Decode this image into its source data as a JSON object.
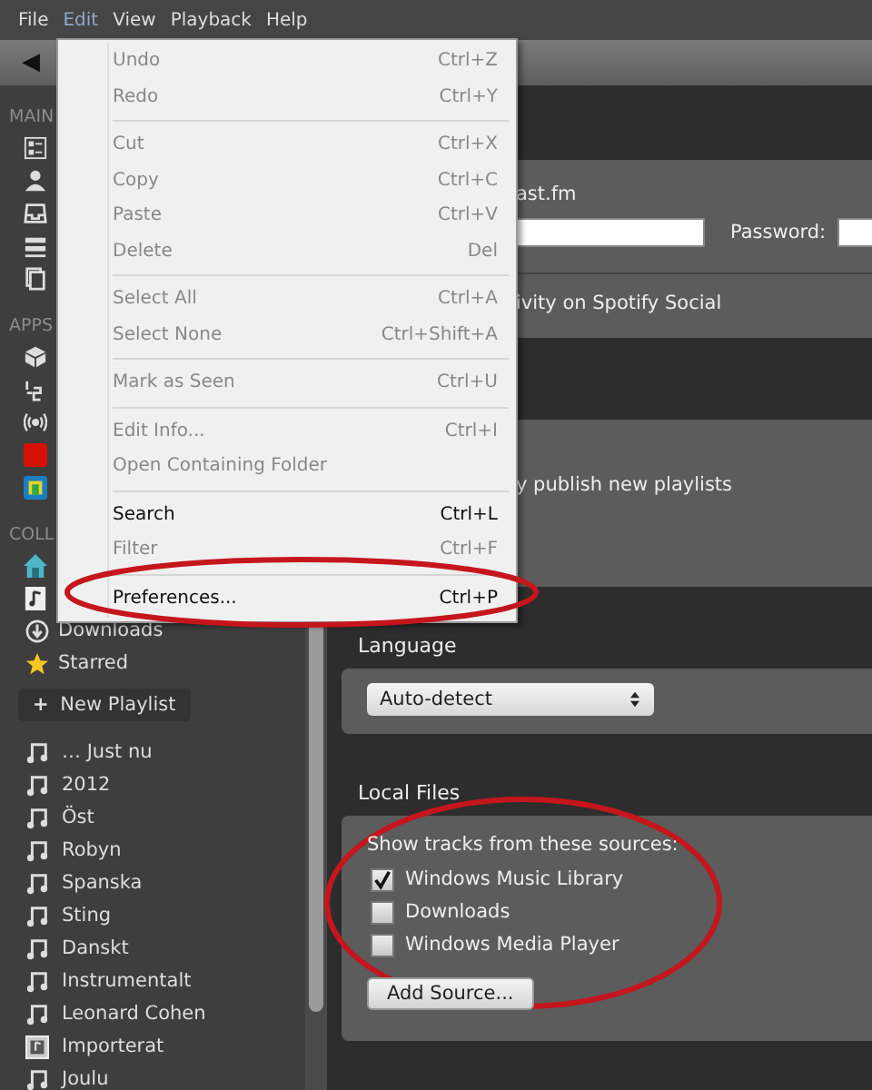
{
  "menubar": [
    {
      "label": "File",
      "selected": false
    },
    {
      "label": "Edit",
      "selected": true
    },
    {
      "label": "View",
      "selected": false
    },
    {
      "label": "Playback",
      "selected": false
    },
    {
      "label": "Help",
      "selected": false
    }
  ],
  "toolbar": {
    "back": "◀"
  },
  "sidebar": {
    "sections": [
      {
        "label": "MAIN"
      },
      {
        "label": "APPS"
      },
      {
        "label": "COLL"
      }
    ],
    "collection_items": [
      {
        "label": "Downloads",
        "kind": "download"
      },
      {
        "label": "Starred",
        "kind": "star"
      }
    ],
    "new_playlist": {
      "icon": "+",
      "label": "New Playlist"
    },
    "playlists": [
      {
        "label": "… Just nu",
        "kind": "note"
      },
      {
        "label": "2012",
        "kind": "note"
      },
      {
        "label": "Öst",
        "kind": "note"
      },
      {
        "label": "Robyn",
        "kind": "note"
      },
      {
        "label": "Spanska",
        "kind": "note"
      },
      {
        "label": "Sting",
        "kind": "note"
      },
      {
        "label": "Danskt",
        "kind": "note"
      },
      {
        "label": "Instrumentalt",
        "kind": "note"
      },
      {
        "label": "Leonard Cohen",
        "kind": "note"
      },
      {
        "label": "Importerat",
        "kind": "folder"
      },
      {
        "label": "Joulu",
        "kind": "note"
      }
    ]
  },
  "edit_menu": {
    "groups": [
      [
        {
          "label": "Undo",
          "shortcut": "Ctrl+Z",
          "disabled": true
        },
        {
          "label": "Redo",
          "shortcut": "Ctrl+Y",
          "disabled": true
        }
      ],
      [
        {
          "label": "Cut",
          "shortcut": "Ctrl+X",
          "disabled": true
        },
        {
          "label": "Copy",
          "shortcut": "Ctrl+C",
          "disabled": true
        },
        {
          "label": "Paste",
          "shortcut": "Ctrl+V",
          "disabled": true
        },
        {
          "label": "Delete",
          "shortcut": "Del",
          "disabled": true
        }
      ],
      [
        {
          "label": "Select All",
          "shortcut": "Ctrl+A",
          "disabled": true
        },
        {
          "label": "Select None",
          "shortcut": "Ctrl+Shift+A",
          "disabled": true
        }
      ],
      [
        {
          "label": "Mark as Seen",
          "shortcut": "Ctrl+U",
          "disabled": true
        }
      ],
      [
        {
          "label": "Edit Info...",
          "shortcut": "Ctrl+I",
          "disabled": true
        },
        {
          "label": "Open Containing Folder",
          "disabled": true
        }
      ],
      [
        {
          "label": "Search",
          "shortcut": "Ctrl+L",
          "disabled": false
        },
        {
          "label": "Filter",
          "shortcut": "Ctrl+F",
          "disabled": true
        }
      ],
      [
        {
          "label": "Preferences...",
          "shortcut": "Ctrl+P",
          "disabled": false
        }
      ]
    ]
  },
  "preferences": {
    "lastfm_label": "ast.fm",
    "password_label": "Password:",
    "social_text": "ivity on Spotify Social",
    "publish_text": "y publish new playlists",
    "language": {
      "heading": "Language",
      "value": "Auto-detect"
    },
    "local_files": {
      "heading": "Local Files",
      "intro": "Show tracks from these sources:",
      "sources": [
        {
          "label": "Windows Music Library",
          "checked": true
        },
        {
          "label": "Downloads",
          "checked": false
        },
        {
          "label": "Windows Media Player",
          "checked": false
        }
      ],
      "add_button": "Add Source..."
    }
  }
}
